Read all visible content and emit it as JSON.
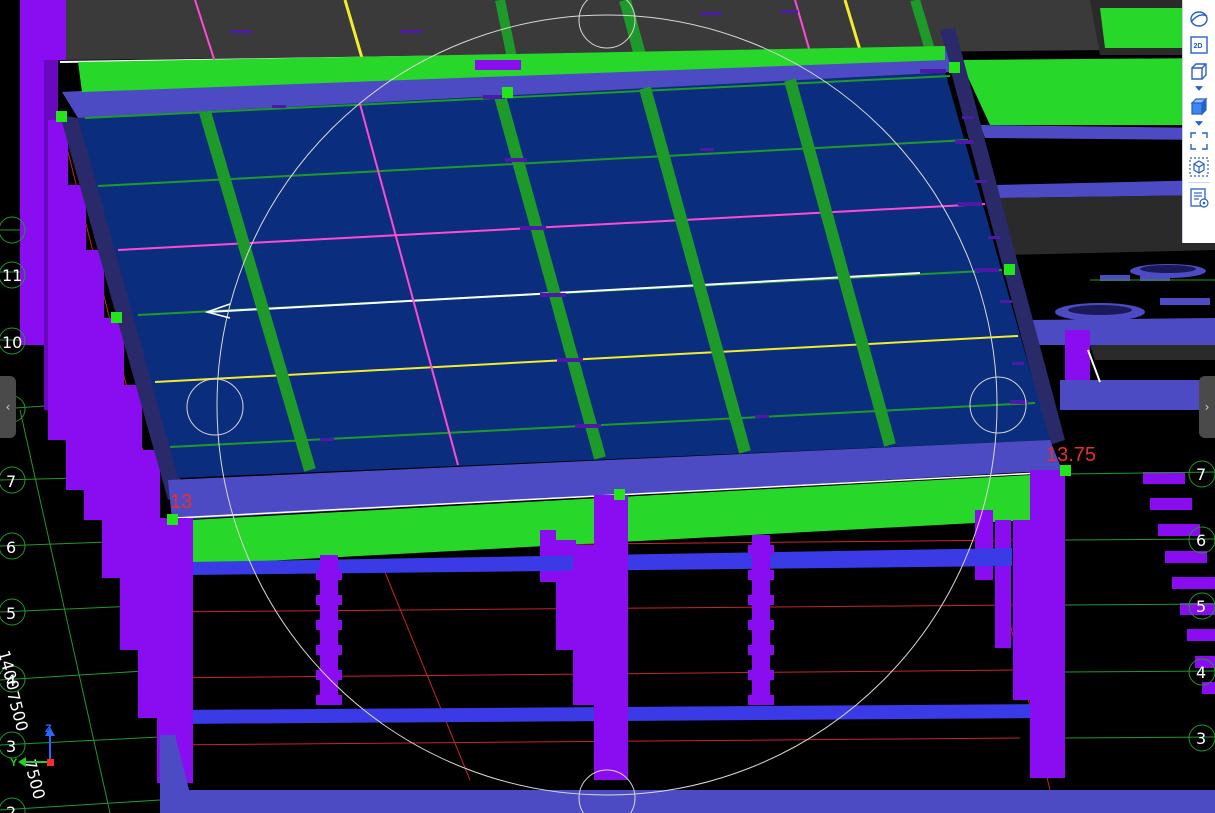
{
  "viewport": {
    "axis_left": [
      "11",
      "10",
      "7",
      "6",
      "5",
      "4",
      "3",
      "2"
    ],
    "axis_right": [
      "7",
      "6",
      "5",
      "4",
      "3"
    ],
    "elevation_left": "13",
    "elevation_right": "13.75",
    "dimension_a": "7500",
    "dimension_b": "7500",
    "dimension_c": "1400",
    "coord_axis": {
      "z": "Z",
      "y": "Y"
    },
    "colors": {
      "slab": "#0b2d7e",
      "beam_top": "#4d4bc4",
      "column": "#8a0cf0",
      "green_band": "#27d82b",
      "grid_line": "#1e9a2a",
      "red_grid": "#c8242a",
      "magenta_line": "#ff4bd2",
      "yellow_line": "#f2ec2c",
      "handle_point": "#22e51a"
    }
  },
  "toolbar": {
    "items": [
      {
        "name": "orbit-icon"
      },
      {
        "name": "2d-view-icon",
        "label": "2D"
      },
      {
        "name": "3d-view-icon"
      },
      {
        "name": "solid-view-icon"
      },
      {
        "name": "fit-screen-icon"
      },
      {
        "name": "select-box-icon"
      },
      {
        "name": "properties-icon"
      }
    ]
  },
  "handles": {
    "left": "‹",
    "right": "›"
  }
}
